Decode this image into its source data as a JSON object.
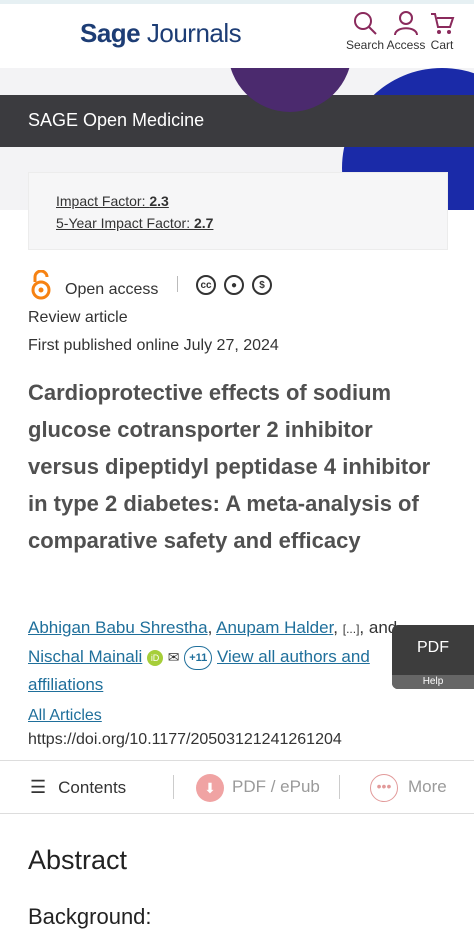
{
  "header": {
    "logo_bold": "Sage",
    "logo_rest": " Journals",
    "search_label": "Search",
    "access_label": "Access",
    "cart_label": "Cart"
  },
  "banner": {
    "journal_title": "SAGE Open Medicine"
  },
  "impact": {
    "impact_label": "Impact Factor: ",
    "impact_value": "2.3",
    "five_year_label": "5-Year Impact Factor: ",
    "five_year_value": "2.7"
  },
  "meta": {
    "open_access": "Open access",
    "article_type": "Review article",
    "published": "First published online July 27, 2024",
    "cc_icons": [
      "cc-icon",
      "by-icon",
      "nc-icon"
    ]
  },
  "article": {
    "title": "Cardioprotective effects of sodium glucose cotransporter 2 inhibitor versus dipeptidyl peptidase 4 inhibitor in type 2 diabetes: A meta-analysis of comparative safety and efficacy"
  },
  "authors": {
    "author1": "Abhigan Babu Shrestha",
    "author2": "Anupam Halder",
    "ellipsis": "[...]",
    "and": ", and",
    "author3": "Nischal Mainali",
    "plus": "+11",
    "view_all": "View all authors and affiliations"
  },
  "pdf_float": {
    "label": "PDF",
    "help": "Help"
  },
  "links": {
    "all_articles": "All Articles",
    "doi": "https://doi.org/10.1177/20503121241261204"
  },
  "toolbar": {
    "contents": "Contents",
    "pdf_epub": "PDF / ePub",
    "more": "More"
  },
  "body": {
    "abstract_heading": "Abstract",
    "background_heading": "Background:"
  }
}
